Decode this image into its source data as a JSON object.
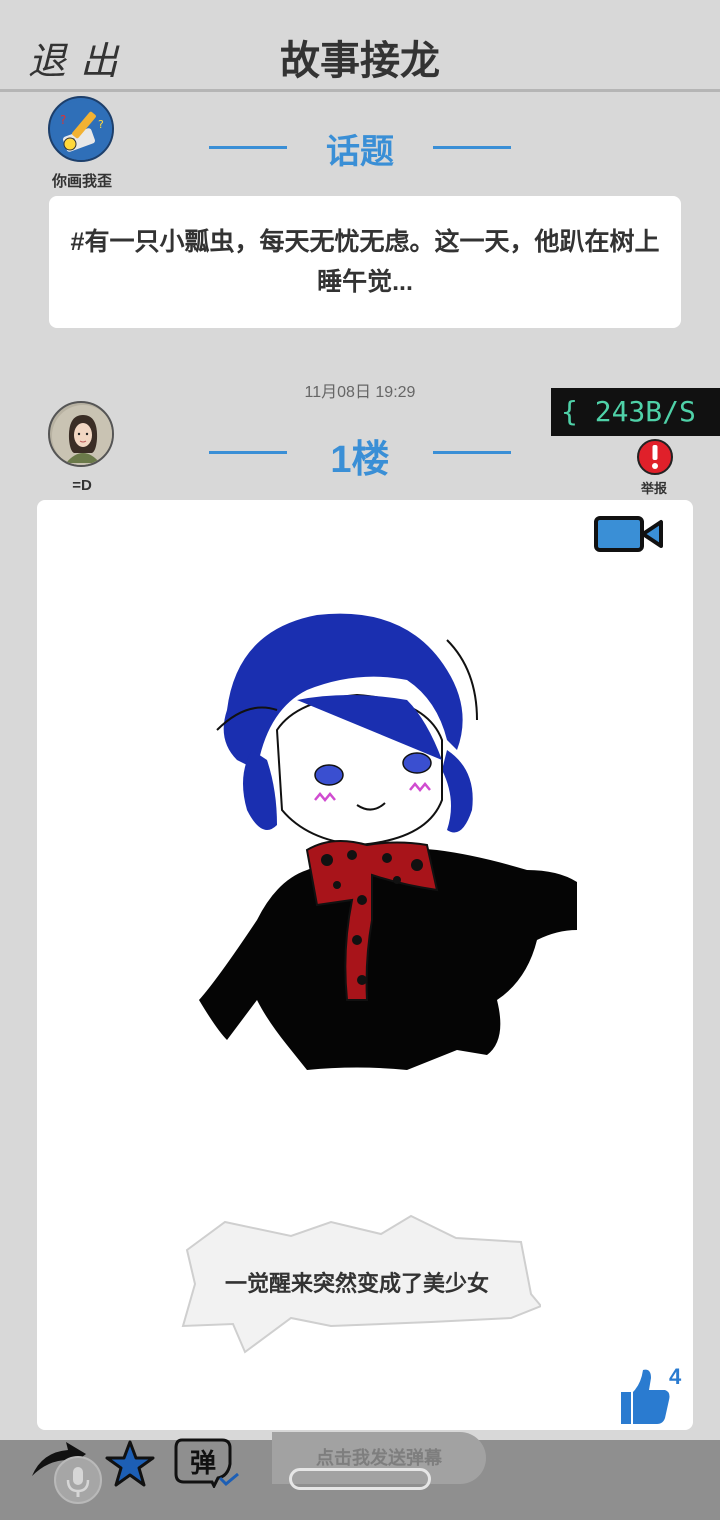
{
  "header": {
    "exit_label": "退出",
    "title": "故事接龙"
  },
  "topic": {
    "user_name": "你画我歪",
    "label": "话题",
    "text": "#有一只小瓢虫，每天无忧无虑。这一天，他趴在树上睡午觉..."
  },
  "floor": {
    "time": "11月08日  19:29",
    "user_name": "=D",
    "label": "1楼",
    "report_label": "举报",
    "caption": "一觉醒来突然变成了美少女",
    "like_count": "4"
  },
  "status": {
    "network_speed": "{ 243B/S"
  },
  "bottom_bar": {
    "danmaku_placeholder": "点击我发送弹幕",
    "danmaku_glyph": "弹"
  },
  "colors": {
    "accent": "#3a8fd6",
    "background": "#d8d8d8",
    "report": "#e0202a",
    "speed_text": "#4fd1a8"
  },
  "icons": [
    "pencil-app-icon",
    "girl-avatar-icon",
    "video-camera-icon",
    "thumbs-up-icon",
    "share-arrow-icon",
    "star-icon",
    "danmaku-icon",
    "microphone-icon",
    "report-exclamation-icon"
  ]
}
